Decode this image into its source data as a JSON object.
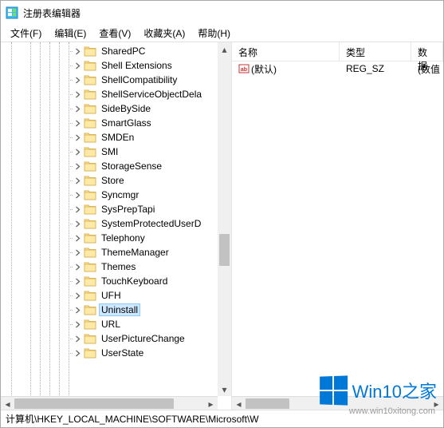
{
  "title": "注册表编辑器",
  "menu": {
    "file": "文件(F)",
    "edit": "编辑(E)",
    "view": "查看(V)",
    "favorites": "收藏夹(A)",
    "help": "帮助(H)"
  },
  "tree": {
    "indent": 96,
    "items": [
      {
        "label": "SharedPC",
        "selected": false
      },
      {
        "label": "Shell Extensions",
        "selected": false
      },
      {
        "label": "ShellCompatibility",
        "selected": false
      },
      {
        "label": "ShellServiceObjectDela",
        "selected": false
      },
      {
        "label": "SideBySide",
        "selected": false
      },
      {
        "label": "SmartGlass",
        "selected": false
      },
      {
        "label": "SMDEn",
        "selected": false
      },
      {
        "label": "SMI",
        "selected": false
      },
      {
        "label": "StorageSense",
        "selected": false
      },
      {
        "label": "Store",
        "selected": false
      },
      {
        "label": "Syncmgr",
        "selected": false
      },
      {
        "label": "SysPrepTapi",
        "selected": false
      },
      {
        "label": "SystemProtectedUserD",
        "selected": false
      },
      {
        "label": "Telephony",
        "selected": false
      },
      {
        "label": "ThemeManager",
        "selected": false
      },
      {
        "label": "Themes",
        "selected": false
      },
      {
        "label": "TouchKeyboard",
        "selected": false
      },
      {
        "label": "UFH",
        "selected": false
      },
      {
        "label": "Uninstall",
        "selected": true
      },
      {
        "label": "URL",
        "selected": false
      },
      {
        "label": "UserPictureChange",
        "selected": false
      },
      {
        "label": "UserState",
        "selected": false
      }
    ],
    "guide_positions": [
      13,
      37,
      49,
      61,
      73,
      85
    ]
  },
  "list": {
    "headers": {
      "name": "名称",
      "type": "类型",
      "data": "数据"
    },
    "rows": [
      {
        "name": "(默认)",
        "type": "REG_SZ",
        "data": "(数值"
      }
    ]
  },
  "status": "计算机\\HKEY_LOCAL_MACHINE\\SOFTWARE\\Microsoft\\W",
  "watermark": {
    "text": "Win10之家",
    "url": "www.win10xitong.com"
  }
}
